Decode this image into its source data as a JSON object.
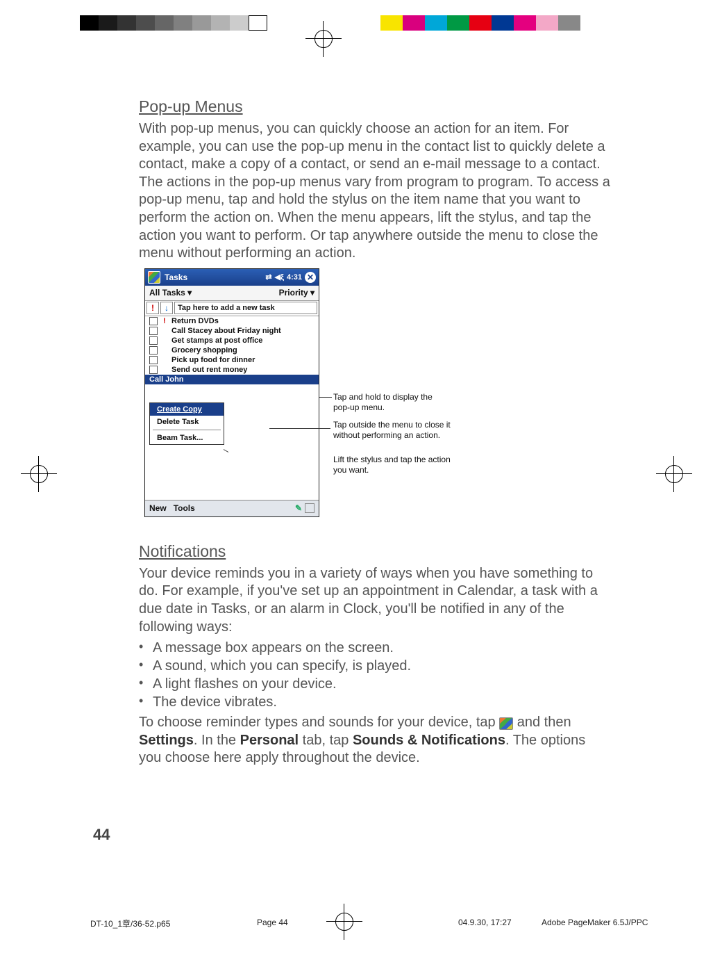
{
  "colorbar_left": [
    "#000000",
    "#1a1a1a",
    "#333333",
    "#4d4d4d",
    "#666666",
    "#808080",
    "#999999",
    "#b3b3b3",
    "#cccccc",
    "#ffffff"
  ],
  "colorbar_right": [
    "#f8e400",
    "#d9007e",
    "#00a7d8",
    "#009944",
    "#e60012",
    "#003893",
    "#e4007f",
    "#f3a8c7",
    "#888888"
  ],
  "section1": {
    "title": "Pop-up Menus",
    "body": "With pop-up menus, you can quickly choose an action for an item. For example, you can use the pop-up menu in the contact list to quickly delete a contact, make a copy of a contact, or send an e-mail message to a contact. The actions in the pop-up menus vary from program to program. To access a pop-up menu, tap and hold the stylus on the item name that you want to perform the action on. When the menu appears, lift the stylus, and tap the action you want to perform. Or tap anywhere outside the menu to close the menu without performing an action."
  },
  "screenshot": {
    "title": "Tasks",
    "time": "4:31",
    "filter_left": "All Tasks",
    "filter_right": "Priority",
    "add_task_placeholder": "Tap here to add a new task",
    "tasks": [
      {
        "pri": "!",
        "label": "Return DVDs"
      },
      {
        "pri": "",
        "label": "Call Stacey about Friday night"
      },
      {
        "pri": "",
        "label": "Get stamps at post office"
      },
      {
        "pri": "",
        "label": "Grocery shopping"
      },
      {
        "pri": "",
        "label": "Pick up food for dinner"
      },
      {
        "pri": "",
        "label": "Send out rent money"
      }
    ],
    "selected_task": "Call John",
    "popup": {
      "items": [
        "Create Copy",
        "Delete Task",
        "Beam Task..."
      ],
      "selected_index": 0
    },
    "bottom": {
      "new": "New",
      "tools": "Tools"
    },
    "annotations": {
      "a1": "Tap and hold to display the pop-up menu.",
      "a2": "Tap outside the menu to close it without performing an action.",
      "a3": "Lift the stylus and tap the action you want."
    }
  },
  "section2": {
    "title": "Notifications",
    "intro": "Your device reminds you in a variety of ways when you have something to do. For example, if you've set up an appointment in Calendar, a task with a due date in Tasks, or an alarm in Clock, you'll be notified in any of the following ways:",
    "bullets": [
      "A message box appears on the screen.",
      "A sound, which you can specify, is played.",
      "A light flashes on your device.",
      "The device vibrates."
    ],
    "tail_pre": "To choose reminder types and sounds for your device, tap ",
    "tail_mid1": " and then ",
    "tail_b1": "Settings",
    "tail_mid2": ". In the ",
    "tail_b2": "Personal",
    "tail_mid3": " tab, tap ",
    "tail_b3": "Sounds & Notifications",
    "tail_post": ". The options you choose here apply throughout the device."
  },
  "page_number": "44",
  "footer": {
    "file": "DT-10_1章/36-52.p65",
    "page": "Page 44",
    "date": "04.9.30, 17:27",
    "app": "Adobe PageMaker 6.5J/PPC"
  }
}
